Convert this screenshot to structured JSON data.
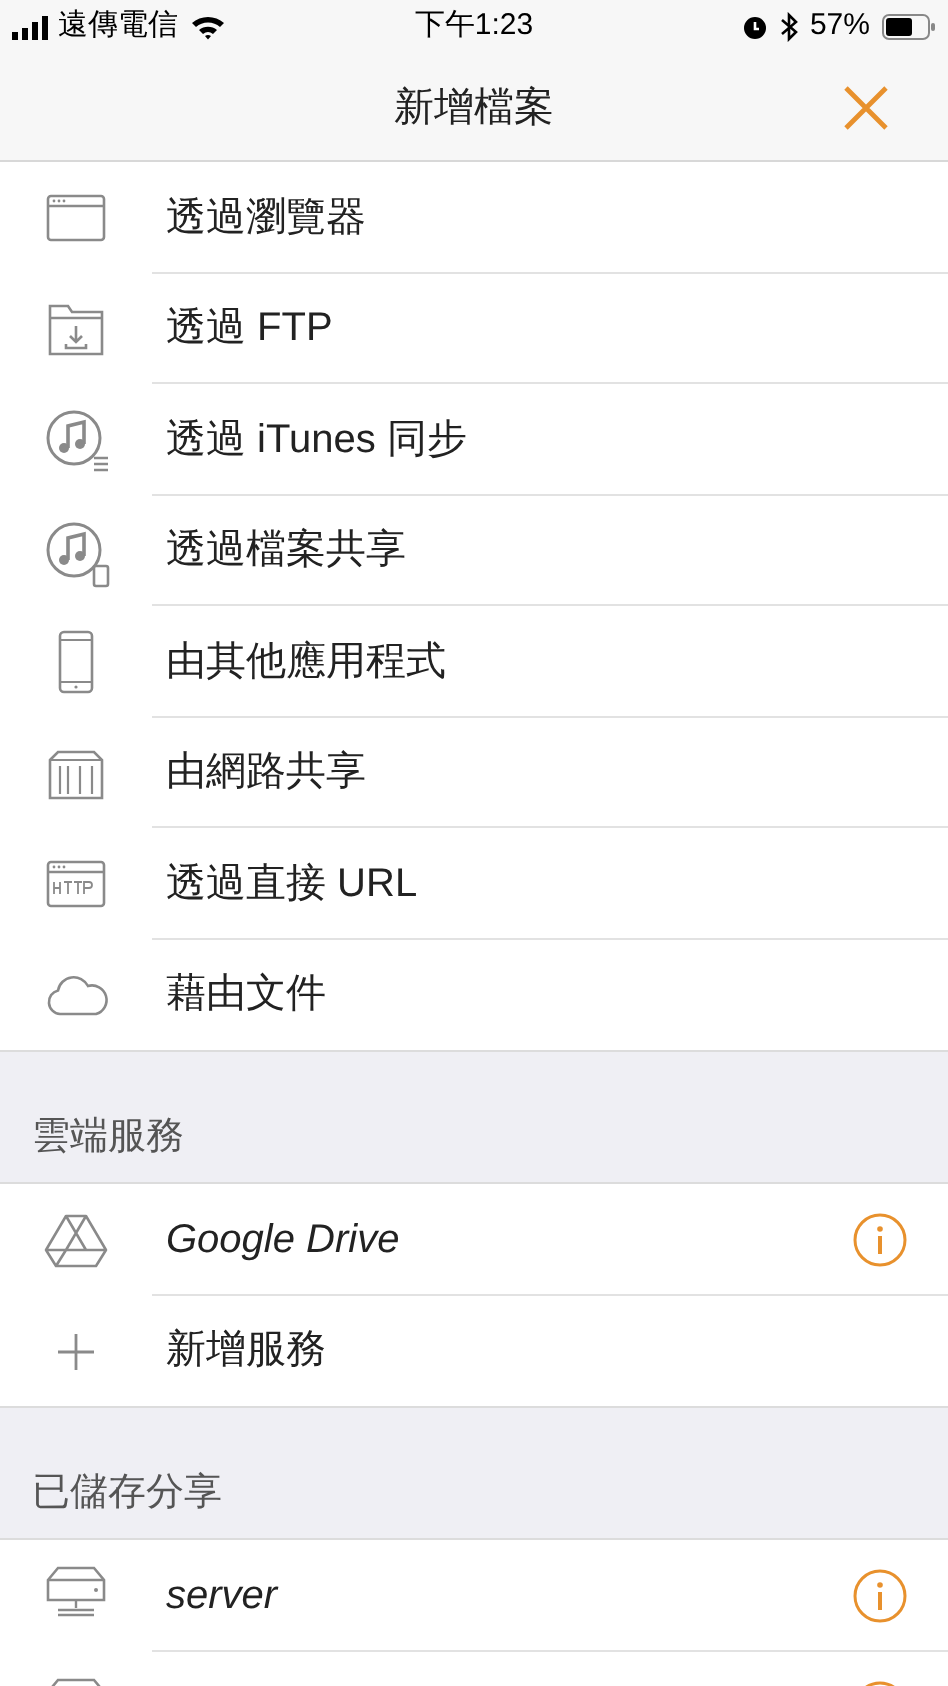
{
  "status_bar": {
    "carrier": "遠傳電信",
    "time": "下午1:23",
    "battery": "57%"
  },
  "nav": {
    "title": "新增檔案"
  },
  "sections": [
    {
      "items": [
        {
          "kind": "browser",
          "label": "透過瀏覽器"
        },
        {
          "kind": "ftp",
          "label": "透過 FTP"
        },
        {
          "kind": "itunes",
          "label": "透過 iTunes 同步"
        },
        {
          "kind": "file-sharing",
          "label": "透過檔案共享"
        },
        {
          "kind": "phone",
          "label": "由其他應用程式"
        },
        {
          "kind": "nas",
          "label": "由網路共享"
        },
        {
          "kind": "http",
          "label": "透過直接 URL"
        },
        {
          "kind": "cloud",
          "label": "藉由文件"
        }
      ]
    },
    {
      "header": "雲端服務",
      "items": [
        {
          "kind": "drive",
          "label": "Google Drive",
          "info_button": true
        },
        {
          "kind": "add",
          "label": "新增服務"
        }
      ]
    },
    {
      "header": "已儲存分享",
      "items": [
        {
          "kind": "server",
          "label": "server",
          "info_button": true
        },
        {
          "kind": "server",
          "info_button": true
        }
      ]
    }
  ]
}
